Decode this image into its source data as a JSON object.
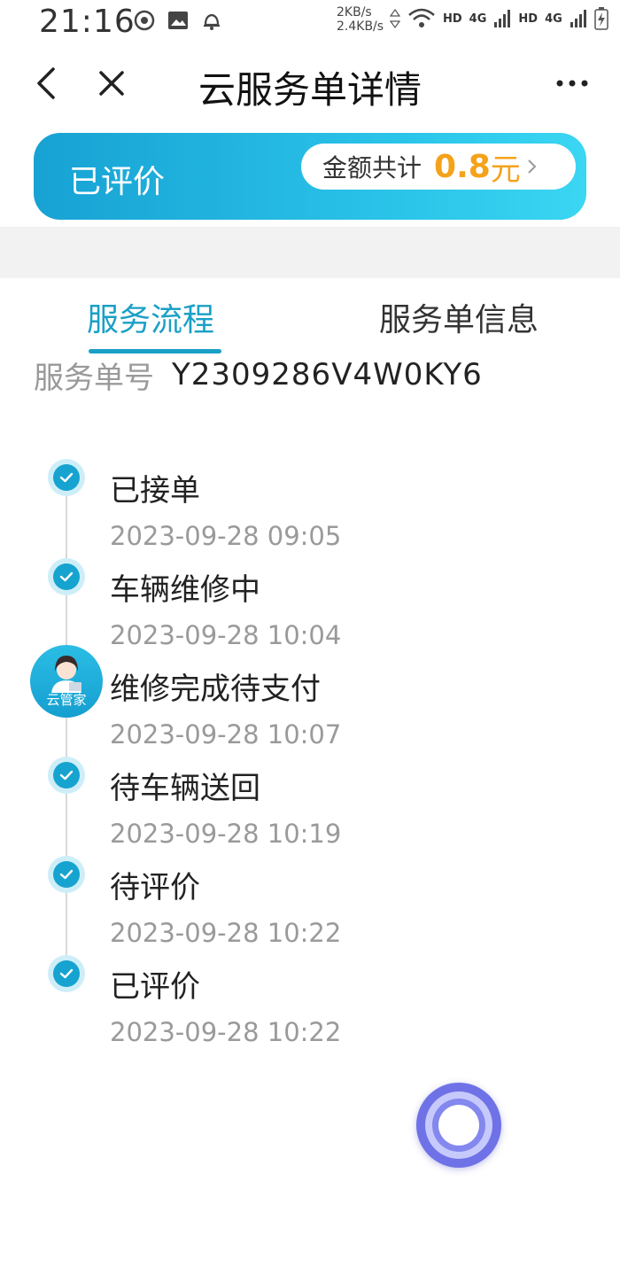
{
  "status_bar": {
    "time": "21:16",
    "speed_up": "2KB/s",
    "speed_down": "2.4KB/s",
    "hd1": "HD",
    "net1": "4G",
    "hd2": "HD",
    "net2": "4G"
  },
  "nav": {
    "title": "云服务单详情"
  },
  "card": {
    "status": "已评价",
    "amount_label": "金额共计",
    "amount_value": "0.8",
    "amount_unit": "元"
  },
  "tabs": [
    {
      "label": "服务流程",
      "active": true
    },
    {
      "label": "服务单信息",
      "active": false
    }
  ],
  "order": {
    "label": "服务单号",
    "number": "Y2309286V4W0KY6"
  },
  "timeline": [
    {
      "title": "已接单",
      "time": "2023-09-28 09:05"
    },
    {
      "title": "车辆维修中",
      "time": "2023-09-28 10:04"
    },
    {
      "title": "维修完成待支付",
      "time": "2023-09-28 10:07"
    },
    {
      "title": "待车辆送回",
      "time": "2023-09-28 10:19"
    },
    {
      "title": "待评价",
      "time": "2023-09-28 10:22"
    },
    {
      "title": "已评价",
      "time": "2023-09-28 10:22"
    }
  ],
  "avatar": {
    "label": "云管家"
  },
  "colors": {
    "accent": "#1aa0c6",
    "amount": "#f5a21b"
  }
}
